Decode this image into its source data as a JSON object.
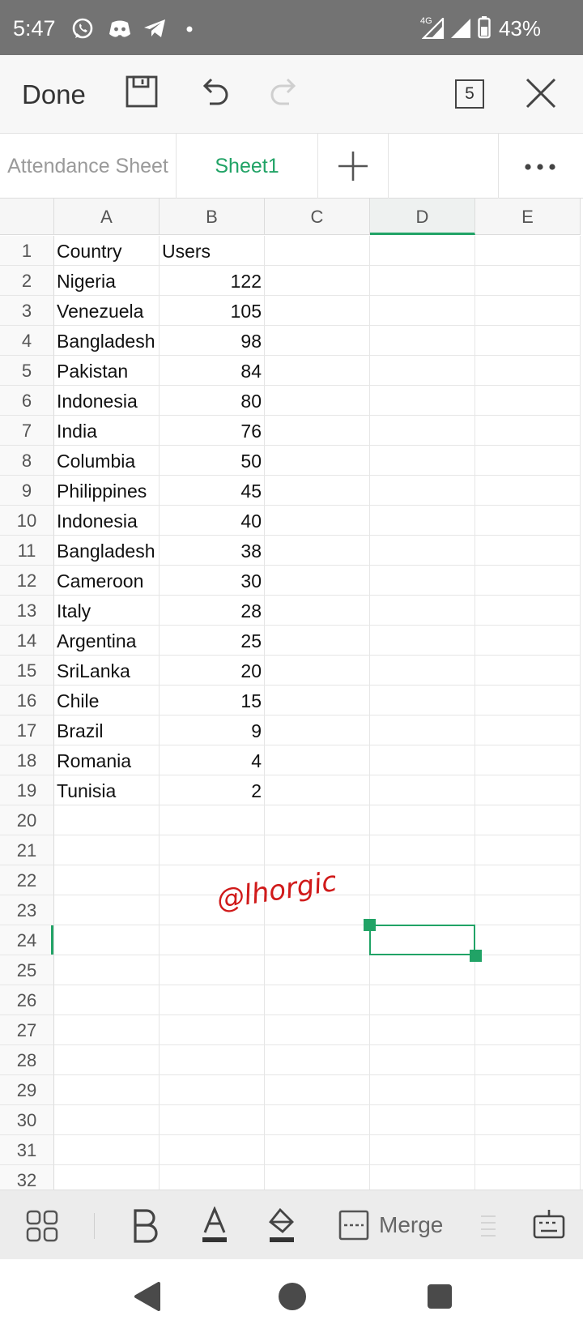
{
  "status_bar": {
    "time": "5:47",
    "network": "4G",
    "battery": "43%",
    "icons": [
      "whatsapp-icon",
      "discord-icon",
      "telegram-icon",
      "dot-icon",
      "signal-icon",
      "signal-icon",
      "battery-icon"
    ]
  },
  "toolbar": {
    "done_label": "Done",
    "tab_count": "5",
    "icons": [
      "save-icon",
      "undo-icon",
      "redo-icon",
      "tab-count-icon",
      "close-icon"
    ]
  },
  "sheet_tabs": {
    "items": [
      {
        "label": "Attendance Sheet",
        "active": false
      },
      {
        "label": "Sheet1",
        "active": true
      }
    ],
    "icons": [
      "add-sheet-icon",
      "more-icon"
    ]
  },
  "grid": {
    "columns": [
      "A",
      "B",
      "C",
      "D",
      "E"
    ],
    "active_column": "D",
    "active_row": "24",
    "row_numbers": [
      "1",
      "2",
      "3",
      "4",
      "5",
      "6",
      "7",
      "8",
      "9",
      "10",
      "11",
      "12",
      "13",
      "14",
      "15",
      "16",
      "17",
      "18",
      "19",
      "20",
      "21",
      "22",
      "23",
      "24",
      "25",
      "26",
      "27",
      "28",
      "29",
      "30",
      "31",
      "32"
    ],
    "rows": [
      [
        "Country",
        "Users"
      ],
      [
        "Nigeria",
        "122"
      ],
      [
        "Venezuela",
        "105"
      ],
      [
        "Bangladesh",
        "98"
      ],
      [
        "Pakistan",
        "84"
      ],
      [
        "Indonesia",
        "80"
      ],
      [
        "India",
        "76"
      ],
      [
        "Columbia",
        "50"
      ],
      [
        "Philippines",
        "45"
      ],
      [
        "Indonesia",
        "40"
      ],
      [
        "Bangladesh",
        "38"
      ],
      [
        "Cameroon",
        "30"
      ],
      [
        "Italy",
        "28"
      ],
      [
        "Argentina",
        "25"
      ],
      [
        "SriLanka",
        "20"
      ],
      [
        "Chile",
        "15"
      ],
      [
        "Brazil",
        "9"
      ],
      [
        "Romania",
        "4"
      ],
      [
        "Tunisia",
        "2"
      ]
    ],
    "selected_cell": "D24",
    "watermark": "@lhorgic",
    "accent_color": "#21a366"
  },
  "format_bar": {
    "merge_label": "Merge",
    "icons": [
      "tools-icon",
      "bold-icon",
      "font-color-icon",
      "fill-color-icon",
      "merge-icon",
      "wrap-icon",
      "keyboard-icon"
    ]
  },
  "nav_bar": {
    "icons": [
      "back-icon",
      "home-icon",
      "recents-icon"
    ]
  }
}
